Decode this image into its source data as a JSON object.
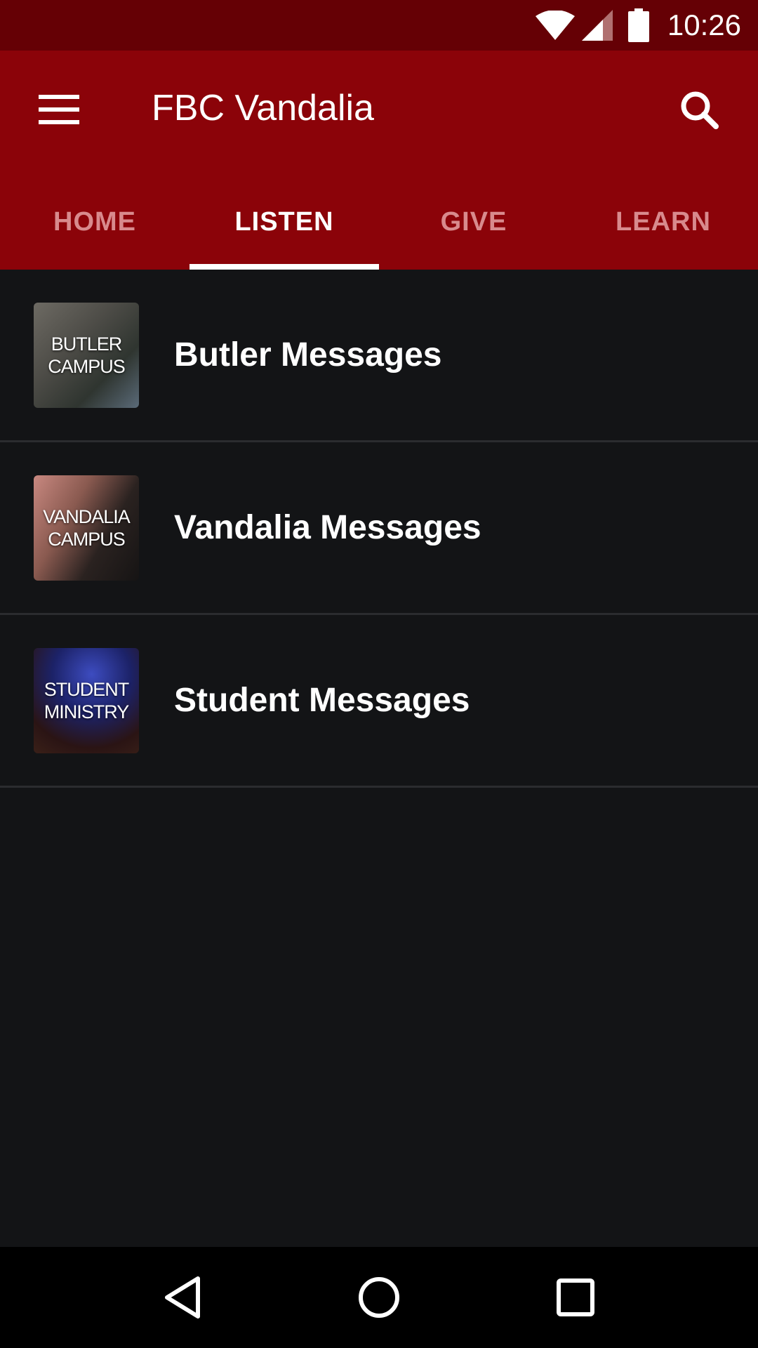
{
  "status_bar": {
    "time": "10:26",
    "icons": [
      "wifi-icon",
      "cell-signal-icon",
      "battery-icon"
    ]
  },
  "app_bar": {
    "title": "FBC Vandalia",
    "menu_icon": "hamburger-menu-icon",
    "search_icon": "search-icon",
    "background_color": "#8b0309"
  },
  "tabs": [
    {
      "label": "HOME",
      "active": false
    },
    {
      "label": "LISTEN",
      "active": true
    },
    {
      "label": "GIVE",
      "active": false
    },
    {
      "label": "LEARN",
      "active": false
    }
  ],
  "list": {
    "items": [
      {
        "label": "Butler Messages",
        "thumb_text": "BUTLER\nCAMPUS"
      },
      {
        "label": "Vandalia Messages",
        "thumb_text": "VANDALIA\nCAMPUS"
      },
      {
        "label": "Student Messages",
        "thumb_text": "STUDENT\nMINISTRY"
      }
    ]
  },
  "nav_bar": {
    "buttons": [
      "back-icon",
      "home-icon",
      "recents-icon"
    ]
  }
}
